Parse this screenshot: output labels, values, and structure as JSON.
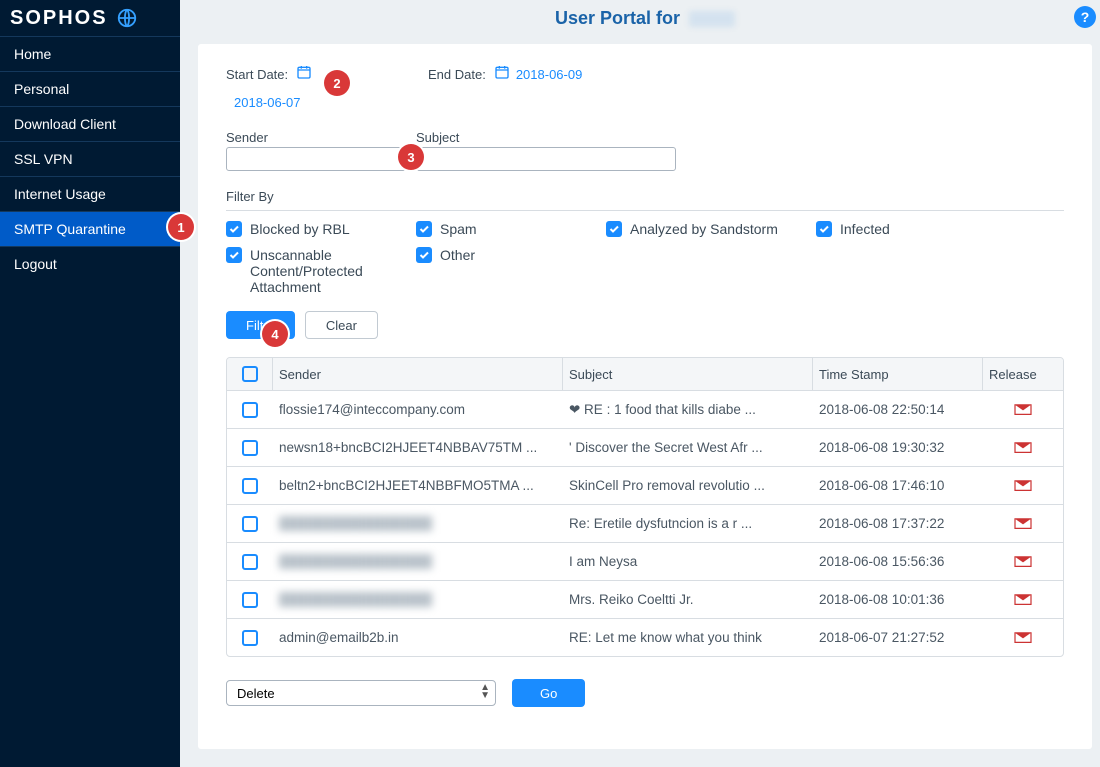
{
  "brand": "SOPHOS",
  "header": {
    "title": "User Portal for"
  },
  "sidebar": {
    "items": [
      {
        "label": "Home"
      },
      {
        "label": "Personal"
      },
      {
        "label": "Download Client"
      },
      {
        "label": "SSL VPN"
      },
      {
        "label": "Internet Usage"
      },
      {
        "label": "SMTP Quarantine",
        "active": true
      },
      {
        "label": "Logout"
      }
    ]
  },
  "dates": {
    "start_label": "Start Date:",
    "start_value": "2018-06-07",
    "end_label": "End Date:",
    "end_value": "2018-06-09"
  },
  "search": {
    "sender_label": "Sender",
    "subject_label": "Subject"
  },
  "filter": {
    "title": "Filter By",
    "options": [
      "Blocked by RBL",
      "Spam",
      "Analyzed by Sandstorm",
      "Infected",
      "Unscannable Content/Protected Attachment",
      "Other"
    ]
  },
  "buttons": {
    "filter": "Filter",
    "clear": "Clear",
    "go": "Go"
  },
  "table": {
    "headers": {
      "sender": "Sender",
      "subject": "Subject",
      "time": "Time Stamp",
      "release": "Release"
    },
    "rows": [
      {
        "sender": "flossie174@inteccompany.com",
        "subject": "❤ RE : 1 food that kills diabe ...",
        "time": "2018-06-08 22:50:14"
      },
      {
        "sender": "newsn18+bncBCI2HJEET4NBBAV75TM ...",
        "subject": "' Discover the Secret West Afr ...",
        "time": "2018-06-08 19:30:32"
      },
      {
        "sender": "beltn2+bncBCI2HJEET4NBBFMO5TMA ...",
        "subject": "SkinCell Pro removal revolutio ...",
        "time": "2018-06-08 17:46:10"
      },
      {
        "sender": "████████████████",
        "subject": "Re: Eretile dysfutncion is a r ...",
        "time": "2018-06-08 17:37:22",
        "blurred": true
      },
      {
        "sender": "████████████████",
        "subject": "I am Neysa",
        "time": "2018-06-08 15:56:36",
        "blurred": true
      },
      {
        "sender": "████████████████",
        "subject": "Mrs. Reiko Coeltti Jr.",
        "time": "2018-06-08 10:01:36",
        "blurred": true
      },
      {
        "sender": "admin@emailb2b.in",
        "subject": "RE: Let me know what you think",
        "time": "2018-06-07 21:27:52"
      }
    ]
  },
  "bulk": {
    "selected": "Delete"
  },
  "callouts": {
    "1": "1",
    "2": "2",
    "3": "3",
    "4": "4"
  }
}
